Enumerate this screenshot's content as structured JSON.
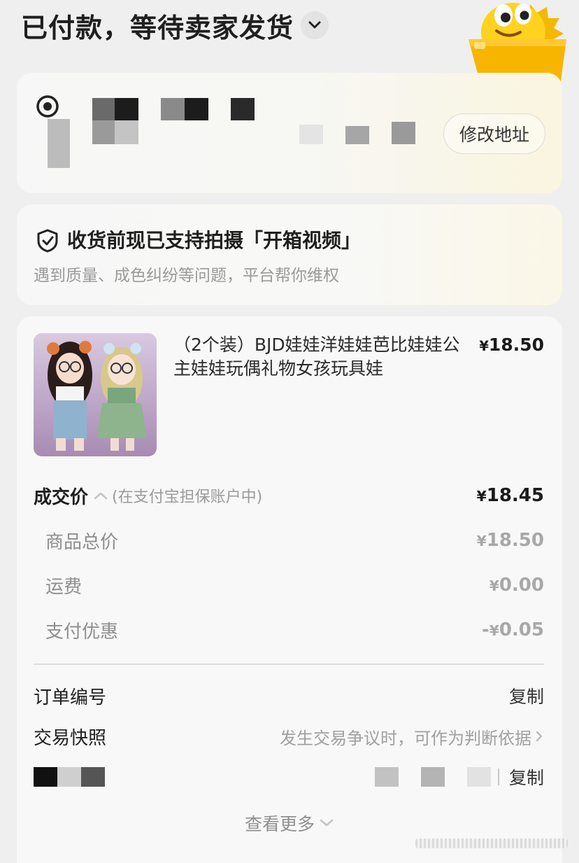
{
  "header": {
    "title": "已付款，等待卖家发货"
  },
  "address": {
    "edit_label": "修改地址"
  },
  "unboxing": {
    "title": "收货前现已支持拍摄「开箱视频」",
    "subtitle": "遇到质量、成色纠纷等问题，平台帮你维权"
  },
  "product": {
    "name": "（2个装）BJD娃娃洋娃娃芭比娃娃公主娃娃玩偶礼物女孩玩具娃",
    "price_symbol": "¥",
    "price_value": "18.50"
  },
  "pricing": {
    "deal": {
      "label": "成交价",
      "note": "(在支付宝担保账户中)",
      "symbol": "¥",
      "value": "18.45"
    },
    "items": [
      {
        "label": "商品总价",
        "prefix": "",
        "symbol": "¥",
        "value": "18.50"
      },
      {
        "label": "运费",
        "prefix": "",
        "symbol": "¥",
        "value": "0.00"
      },
      {
        "label": "支付优惠",
        "prefix": "-",
        "symbol": "¥",
        "value": "0.05"
      }
    ]
  },
  "order_info": {
    "order_number_label": "订单编号",
    "copy_label": "复制",
    "snapshot_label": "交易快照",
    "snapshot_note": "发生交易争议时，可作为判断依据",
    "second_copy_label": "复制",
    "more_label": "查看更多"
  },
  "colors": {
    "background": "#efefef",
    "card": "#f8f8f8",
    "mascot": "#ffd21f"
  }
}
